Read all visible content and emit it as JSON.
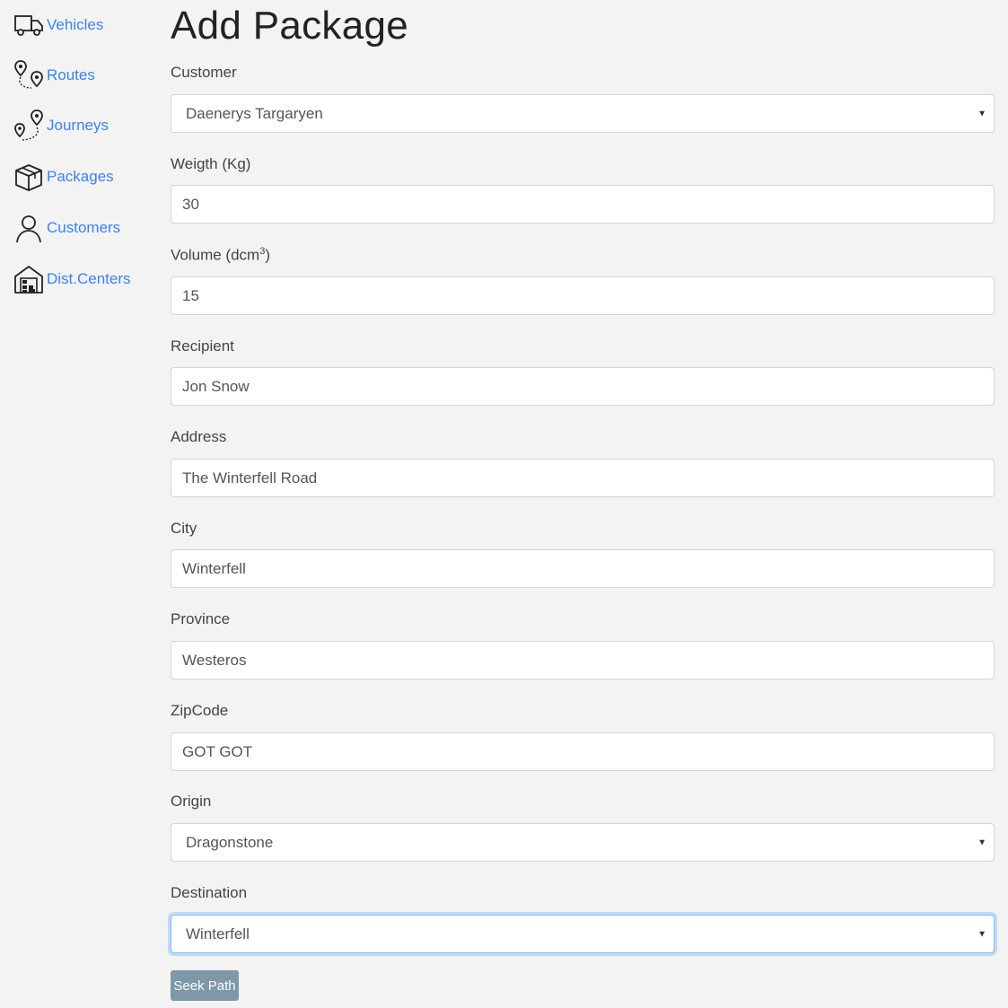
{
  "sidebar": {
    "items": [
      {
        "label": "Vehicles",
        "icon": "truck-icon"
      },
      {
        "label": "Routes",
        "icon": "route-pins-icon"
      },
      {
        "label": "Journeys",
        "icon": "journey-pins-icon"
      },
      {
        "label": "Packages",
        "icon": "package-box-icon"
      },
      {
        "label": "Customers",
        "icon": "user-icon"
      },
      {
        "label": "Dist.Centers",
        "icon": "warehouse-icon"
      }
    ],
    "link_color": "#3b82f6"
  },
  "form": {
    "title": "Add Package",
    "customer": {
      "label": "Customer",
      "value": "Daenerys Targaryen"
    },
    "weight": {
      "label": "Weigth (Kg)",
      "value": "30"
    },
    "volume": {
      "label": "Volume (dcm",
      "label_sup": "3",
      "label_end": ")",
      "value": "15"
    },
    "recipient": {
      "label": "Recipient",
      "value": "Jon Snow"
    },
    "address": {
      "label": "Address",
      "value": "The Winterfell Road"
    },
    "city": {
      "label": "City",
      "value": "Winterfell"
    },
    "province": {
      "label": "Province",
      "value": "Westeros"
    },
    "zipcode": {
      "label": "ZipCode",
      "value": "GOT GOT"
    },
    "origin": {
      "label": "Origin",
      "value": "Dragonstone"
    },
    "destination": {
      "label": "Destination",
      "value": "Winterfell"
    },
    "seek_button": "Seek Path"
  },
  "colors": {
    "background": "#f3f3f3",
    "button": "#7e98a8",
    "focus_ring": "#80bdff"
  }
}
